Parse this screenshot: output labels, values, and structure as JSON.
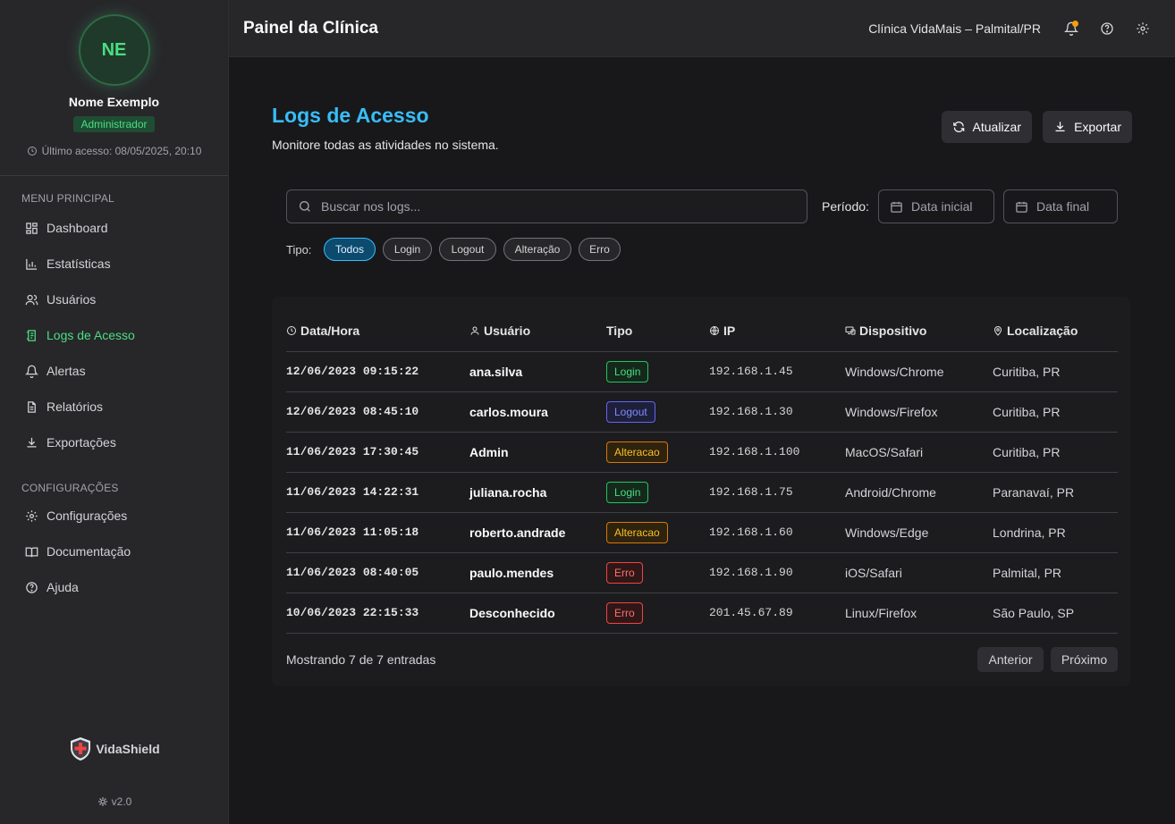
{
  "user": {
    "initials": "NE",
    "name": "Nome Exemplo",
    "role": "Administrador",
    "last_access": "Último acesso: 08/05/2025, 20:10"
  },
  "sidebar": {
    "main_title": "MENU PRINCIPAL",
    "main_items": [
      {
        "label": "Dashboard",
        "icon": "dashboard-icon"
      },
      {
        "label": "Estatísticas",
        "icon": "bar-chart-icon"
      },
      {
        "label": "Usuários",
        "icon": "users-icon"
      },
      {
        "label": "Logs de Acesso",
        "icon": "logs-icon",
        "active": true
      },
      {
        "label": "Alertas",
        "icon": "bell-icon"
      },
      {
        "label": "Relatórios",
        "icon": "file-icon"
      },
      {
        "label": "Exportações",
        "icon": "download-icon"
      }
    ],
    "config_title": "CONFIGURAÇÕES",
    "config_items": [
      {
        "label": "Configurações",
        "icon": "gear-icon"
      },
      {
        "label": "Documentação",
        "icon": "book-icon"
      },
      {
        "label": "Ajuda",
        "icon": "help-icon"
      }
    ],
    "brand": "VidaShield",
    "version": "v2.0"
  },
  "header": {
    "title": "Painel da Clínica",
    "clinic": "Clínica VidaMais – Palmital/PR"
  },
  "page": {
    "title": "Logs de Acesso",
    "subtitle": "Monitore todas as atividades no sistema.",
    "refresh_label": "Atualizar",
    "export_label": "Exportar"
  },
  "filters": {
    "search_placeholder": "Buscar nos logs...",
    "period_label": "Período:",
    "date_start": "Data inicial",
    "date_end": "Data final",
    "type_label": "Tipo:",
    "types": [
      "Todos",
      "Login",
      "Logout",
      "Alteração",
      "Erro"
    ],
    "active_type": "Todos"
  },
  "table": {
    "columns": [
      "Data/Hora",
      "Usuário",
      "Tipo",
      "IP",
      "Dispositivo",
      "Localização"
    ],
    "rows": [
      {
        "datetime": "12/06/2023 09:15:22",
        "user": "ana.silva",
        "type": "Login",
        "kind": "login",
        "ip": "192.168.1.45",
        "device": "Windows/Chrome",
        "location": "Curitiba, PR"
      },
      {
        "datetime": "12/06/2023 08:45:10",
        "user": "carlos.moura",
        "type": "Logout",
        "kind": "logout",
        "ip": "192.168.1.30",
        "device": "Windows/Firefox",
        "location": "Curitiba, PR"
      },
      {
        "datetime": "11/06/2023 17:30:45",
        "user": "Admin",
        "type": "Alteracao",
        "kind": "alteracao",
        "ip": "192.168.1.100",
        "device": "MacOS/Safari",
        "location": "Curitiba, PR"
      },
      {
        "datetime": "11/06/2023 14:22:31",
        "user": "juliana.rocha",
        "type": "Login",
        "kind": "login",
        "ip": "192.168.1.75",
        "device": "Android/Chrome",
        "location": "Paranavaí, PR"
      },
      {
        "datetime": "11/06/2023 11:05:18",
        "user": "roberto.andrade",
        "type": "Alteracao",
        "kind": "alteracao",
        "ip": "192.168.1.60",
        "device": "Windows/Edge",
        "location": "Londrina, PR"
      },
      {
        "datetime": "11/06/2023 08:40:05",
        "user": "paulo.mendes",
        "type": "Erro",
        "kind": "erro",
        "ip": "192.168.1.90",
        "device": "iOS/Safari",
        "location": "Palmital, PR"
      },
      {
        "datetime": "10/06/2023 22:15:33",
        "user": "Desconhecido",
        "type": "Erro",
        "kind": "erro",
        "ip": "201.45.67.89",
        "device": "Linux/Firefox",
        "location": "São Paulo, SP"
      }
    ]
  },
  "pagination": {
    "summary": "Mostrando 7 de 7 entradas",
    "prev_label": "Anterior",
    "next_label": "Próximo"
  },
  "colors": {
    "accent_green": "#4ade80",
    "accent_blue": "#38bdf8",
    "notification": "#f59e0b"
  }
}
